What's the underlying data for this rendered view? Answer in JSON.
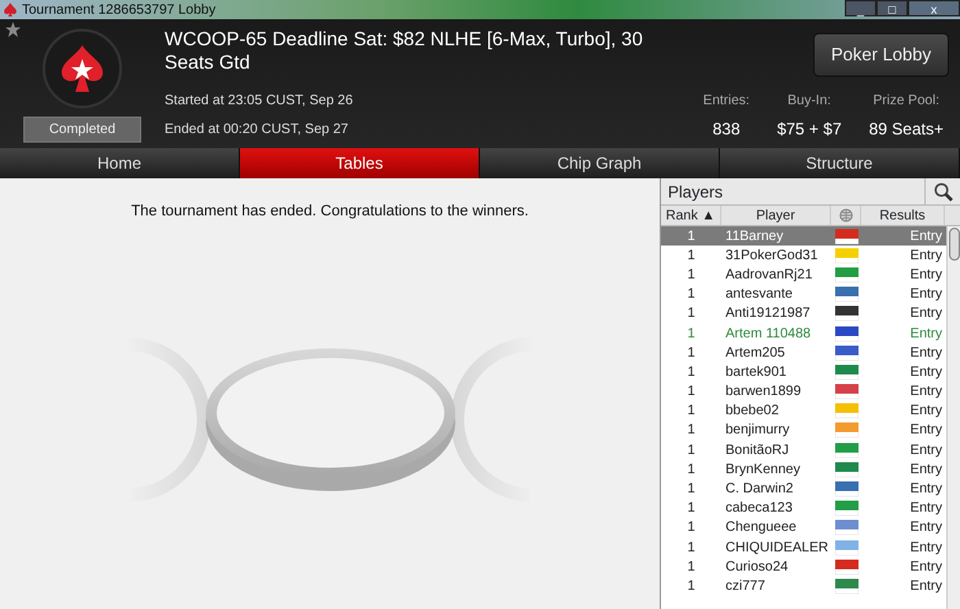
{
  "window": {
    "title": "Tournament 1286653797 Lobby",
    "controls": [
      "_",
      "□",
      "x"
    ]
  },
  "header": {
    "favorite": false,
    "title": "WCOOP-65 Deadline Sat: $82 NLHE [6-Max, Turbo], 30 Seats Gtd",
    "status": "Completed",
    "started": "Started at 23:05 CUST, Sep 26",
    "ended": "Ended at 00:20 CUST, Sep 27",
    "lobby_button": "Poker Lobby",
    "stats": [
      {
        "label": "Entries:",
        "value": "838"
      },
      {
        "label": "Buy-In:",
        "value": "$75 + $7"
      },
      {
        "label": "Prize Pool:",
        "value": "89 Seats+"
      }
    ]
  },
  "tabs": [
    {
      "label": "Home",
      "selected": false
    },
    {
      "label": "Tables",
      "selected": true
    },
    {
      "label": "Chip Graph",
      "selected": false
    },
    {
      "label": "Structure",
      "selected": false
    }
  ],
  "message": "The tournament has ended. Congratulations to the winners.",
  "players": {
    "title": "Players",
    "columns": [
      "Rank ▲",
      "Player",
      "Results"
    ],
    "rows": [
      {
        "rank": "1",
        "player": "11Barney",
        "result": "Entry",
        "selected": true,
        "highlighted": false,
        "color": "#d52b1e"
      },
      {
        "rank": "1",
        "player": "31PokerGod31",
        "result": "Entry",
        "selected": false,
        "highlighted": false,
        "color": "#f5d000"
      },
      {
        "rank": "1",
        "player": "AadrovanRj21",
        "result": "Entry",
        "selected": false,
        "highlighted": false,
        "color": "#229e45"
      },
      {
        "rank": "1",
        "player": "antesvante",
        "result": "Entry",
        "selected": false,
        "highlighted": false,
        "color": "#3a6fb0"
      },
      {
        "rank": "1",
        "player": "Anti19121987",
        "result": "Entry",
        "selected": false,
        "highlighted": false,
        "color": "#333333"
      },
      {
        "rank": "1",
        "player": "Artem 110488",
        "result": "Entry",
        "selected": false,
        "highlighted": true,
        "color": "#2b49c3"
      },
      {
        "rank": "1",
        "player": "Artem205",
        "result": "Entry",
        "selected": false,
        "highlighted": false,
        "color": "#3a5cc8"
      },
      {
        "rank": "1",
        "player": "bartek901",
        "result": "Entry",
        "selected": false,
        "highlighted": false,
        "color": "#1e8a4c"
      },
      {
        "rank": "1",
        "player": "barwen1899",
        "result": "Entry",
        "selected": false,
        "highlighted": false,
        "color": "#d5404a"
      },
      {
        "rank": "1",
        "player": "bbebe02",
        "result": "Entry",
        "selected": false,
        "highlighted": false,
        "color": "#f5c000"
      },
      {
        "rank": "1",
        "player": "benjimurry",
        "result": "Entry",
        "selected": false,
        "highlighted": false,
        "color": "#f39a30"
      },
      {
        "rank": "1",
        "player": "BonitãoRJ",
        "result": "Entry",
        "selected": false,
        "highlighted": false,
        "color": "#229e46"
      },
      {
        "rank": "1",
        "player": "BrynKenney",
        "result": "Entry",
        "selected": false,
        "highlighted": false,
        "color": "#1e8a4d"
      },
      {
        "rank": "1",
        "player": "C. Darwin2",
        "result": "Entry",
        "selected": false,
        "highlighted": false,
        "color": "#3a6fb1"
      },
      {
        "rank": "1",
        "player": "cabeca123",
        "result": "Entry",
        "selected": false,
        "highlighted": false,
        "color": "#229e47"
      },
      {
        "rank": "1",
        "player": "Chengueee",
        "result": "Entry",
        "selected": false,
        "highlighted": false,
        "color": "#6d8fd0"
      },
      {
        "rank": "1",
        "player": "CHIQUIDEALER",
        "result": "Entry",
        "selected": false,
        "highlighted": false,
        "color": "#7fb2e5"
      },
      {
        "rank": "1",
        "player": "Curioso24",
        "result": "Entry",
        "selected": false,
        "highlighted": false,
        "color": "#d52b1f"
      },
      {
        "rank": "1",
        "player": "czi777",
        "result": "Entry",
        "selected": false,
        "highlighted": false,
        "color": "#2e8a4c"
      }
    ]
  }
}
